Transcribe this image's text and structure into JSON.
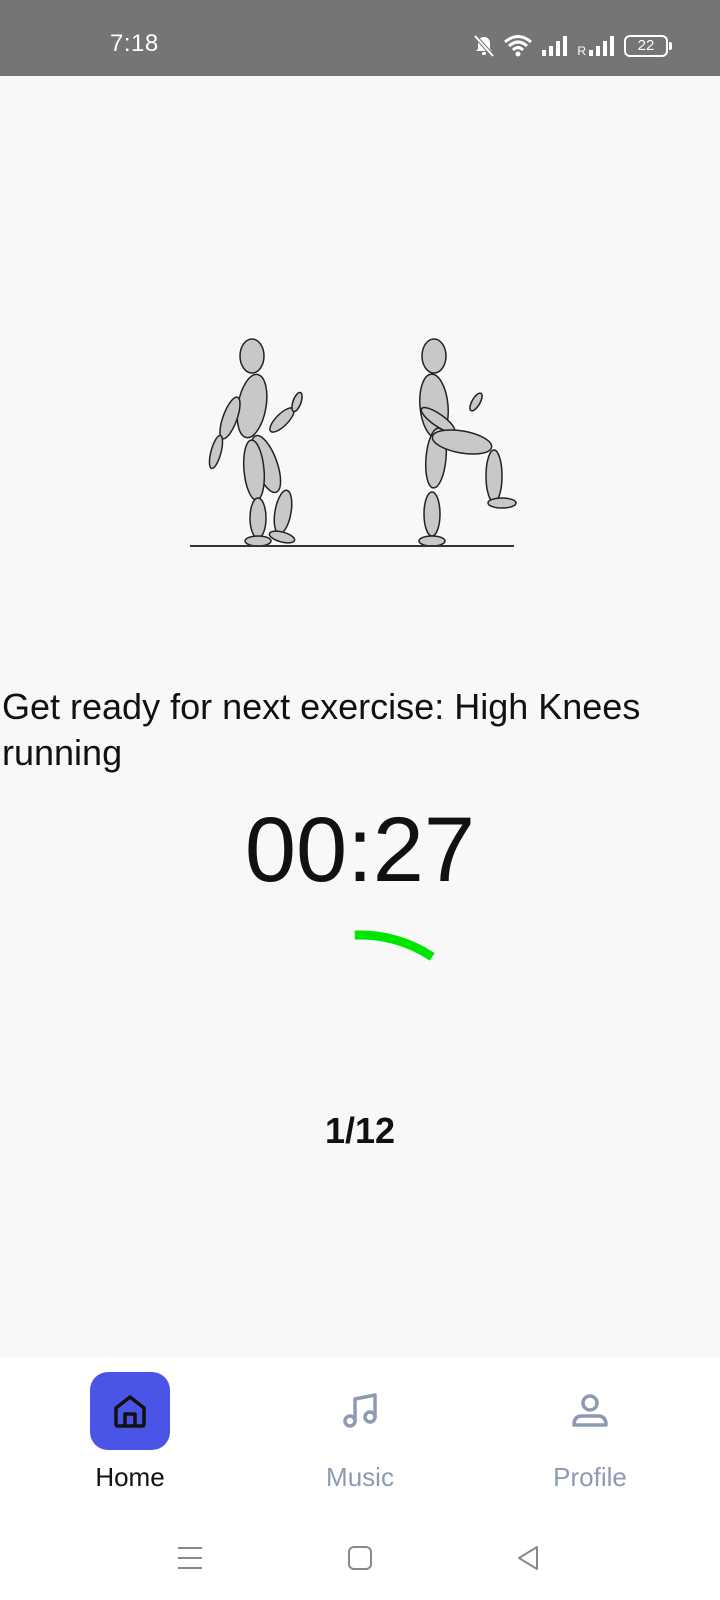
{
  "status_bar": {
    "time": "7:18",
    "battery_level": "22",
    "icons": [
      "mute-icon",
      "wifi-icon",
      "signal-icon",
      "roaming-signal-icon",
      "battery-icon"
    ],
    "roaming_label": "R"
  },
  "workout": {
    "illustration_icon": "high-knees-figures",
    "message": "Get ready for next exercise: High Knees running",
    "timer": "00:27",
    "progress_fraction": 0.1,
    "progress_color": "#00e600",
    "counter": "1/12"
  },
  "bottom_nav": {
    "items": [
      {
        "label": "Home",
        "icon": "home-icon",
        "active": true
      },
      {
        "label": "Music",
        "icon": "music-note-icon",
        "active": false
      },
      {
        "label": "Profile",
        "icon": "profile-icon",
        "active": false
      }
    ],
    "accent_color": "#4a55e8",
    "inactive_color": "#8e99b4"
  },
  "system_nav": {
    "icons": [
      "menu-icon",
      "home-square-icon",
      "back-icon"
    ]
  }
}
